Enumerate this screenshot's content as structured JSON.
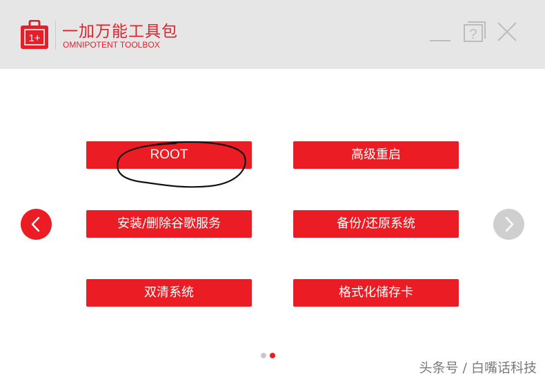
{
  "app": {
    "title_cn": "一加万能工具包",
    "title_en": "OMNIPOTENT TOOLBOX",
    "logo_icon": "oneplus-toolbox-icon",
    "logo_glyph": "1+"
  },
  "window_controls": {
    "minimize_icon": "minimize-icon",
    "help_icon": "help-icon",
    "help_glyph": "?",
    "close_icon": "close-icon"
  },
  "buttons": [
    {
      "label": "ROOT"
    },
    {
      "label": "高级重启"
    },
    {
      "label": "安装/删除谷歌服务"
    },
    {
      "label": "备份/还原系统"
    },
    {
      "label": "双清系统"
    },
    {
      "label": "格式化储存卡"
    }
  ],
  "pager": {
    "prev_icon": "chevron-left-icon",
    "next_icon": "chevron-right-icon",
    "pages": 2,
    "current_page": 2
  },
  "watermark": "头条号 / 白嘴话科技",
  "colors": {
    "accent": "#ec1c24",
    "header_bg": "#e6e6e6",
    "disabled": "#cfcfcf"
  }
}
